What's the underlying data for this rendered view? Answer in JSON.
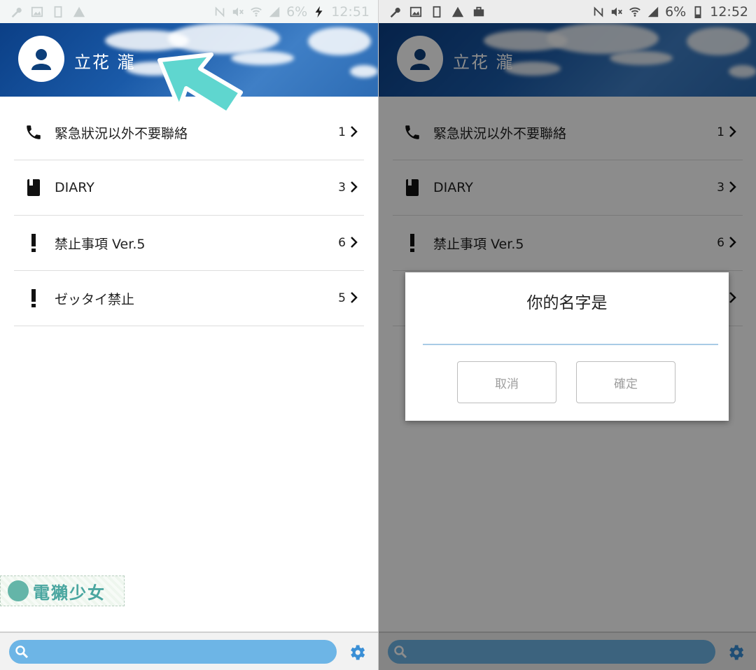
{
  "left": {
    "status": {
      "battery": "6%",
      "time": "12:51"
    },
    "user": {
      "name": "立花 瀧"
    },
    "list": [
      {
        "label": "緊急狀況以外不要聯絡",
        "count": "1",
        "icon": "phone-icon"
      },
      {
        "label": "DIARY",
        "count": "3",
        "icon": "book-icon"
      },
      {
        "label": "禁止事項 Ver.5",
        "count": "6",
        "icon": "exclamation-icon"
      },
      {
        "label": "ゼッタイ禁止",
        "count": "5",
        "icon": "exclamation-icon"
      }
    ],
    "watermark": "電獺少女"
  },
  "right": {
    "status": {
      "battery": "6%",
      "time": "12:52"
    },
    "user": {
      "name": "立花 瀧"
    },
    "list": [
      {
        "label": "緊急狀況以外不要聯絡",
        "count": "1",
        "icon": "phone-icon"
      },
      {
        "label": "DIARY",
        "count": "3",
        "icon": "book-icon"
      },
      {
        "label": "禁止事項 Ver.5",
        "count": "6",
        "icon": "exclamation-icon"
      },
      {
        "label": "",
        "count": "",
        "icon": ""
      }
    ],
    "dialog": {
      "title": "你的名字是",
      "input_value": "",
      "cancel_label": "取消",
      "ok_label": "確定"
    }
  },
  "colors": {
    "search_bar": "#6db5e6",
    "gear": "#3a8fd6",
    "arrow": "#5fd6cf",
    "header": "#1a5aa8"
  }
}
